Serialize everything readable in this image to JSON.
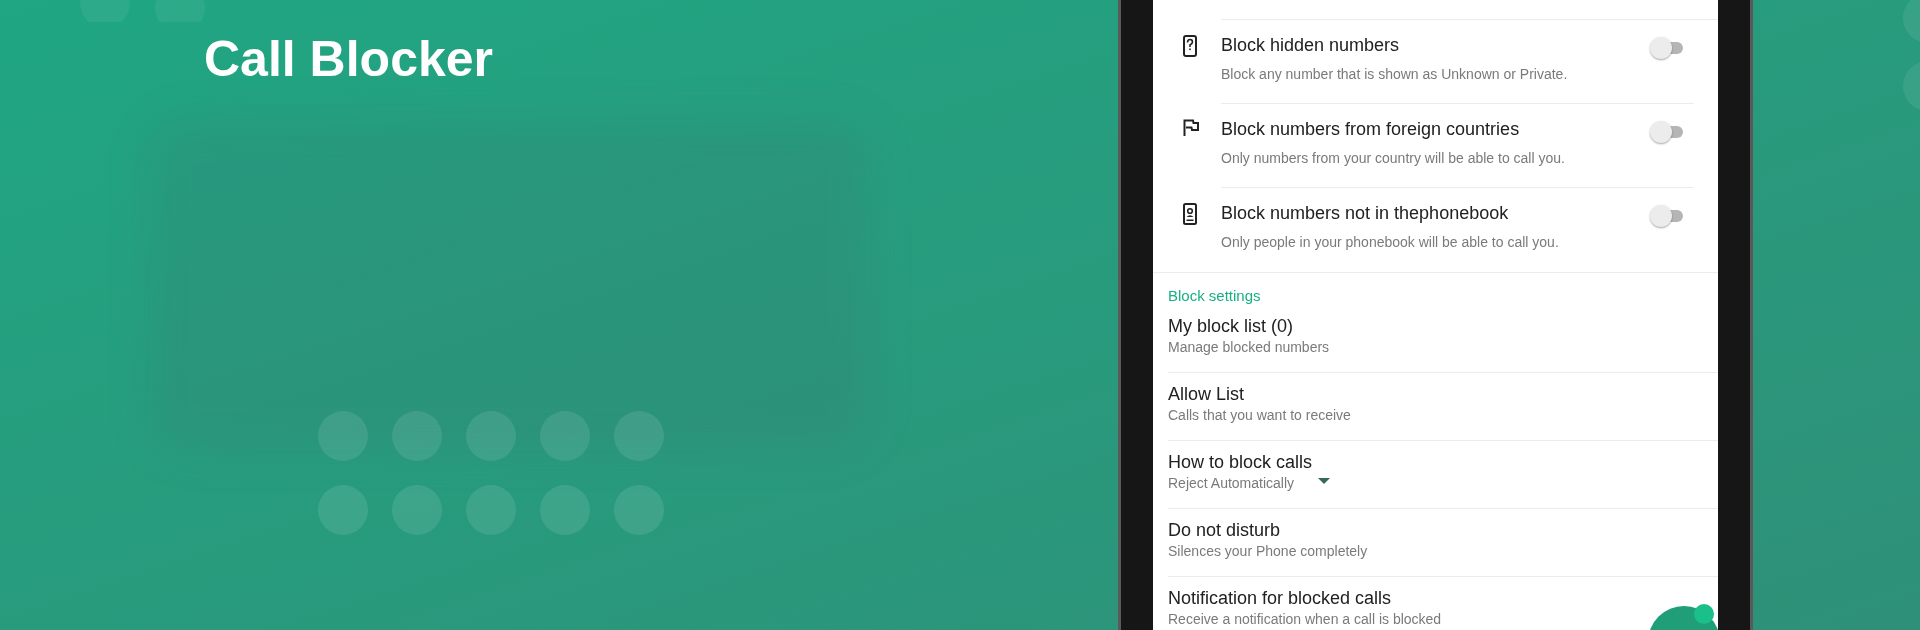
{
  "banner": {
    "title": "Call Blocker"
  },
  "toggles": [
    {
      "kind": "hidden",
      "title": "Block hidden numbers",
      "description": "Block any number that is shown as Unknown or Private.",
      "on": false
    },
    {
      "kind": "foreign",
      "title": "Block numbers from foreign countries",
      "description": "Only numbers from your country will be able to call you.",
      "on": false
    },
    {
      "kind": "contacts",
      "title": "Block numbers not in thephonebook",
      "description": "Only people in your phonebook will be able to call you.",
      "on": false
    }
  ],
  "section": {
    "title": "Block settings",
    "items": [
      {
        "kind": "plain",
        "title": "My block list (0)",
        "subtitle": "Manage blocked numbers"
      },
      {
        "kind": "plain",
        "title": "Allow List",
        "subtitle": "Calls that you want to receive"
      },
      {
        "kind": "dropdown",
        "title": "How to block calls",
        "subtitle": "Reject Automatically"
      },
      {
        "kind": "plain",
        "title": "Do not disturb",
        "subtitle": "Silences your Phone completely"
      },
      {
        "kind": "plain",
        "title": "Notification for blocked calls",
        "subtitle": "Receive a notification when a call is blocked"
      }
    ]
  }
}
